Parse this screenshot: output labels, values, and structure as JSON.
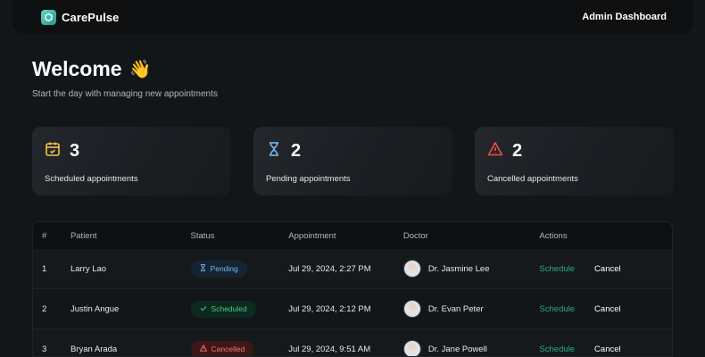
{
  "header": {
    "brand": "CarePulse",
    "right_label": "Admin Dashboard"
  },
  "welcome": {
    "title": "Welcome",
    "emoji": "👋",
    "subtitle": "Start the day with managing new appointments"
  },
  "stats": [
    {
      "count": "3",
      "label": "Scheduled appointments",
      "icon": "calendar-icon",
      "color": "#f5c542"
    },
    {
      "count": "2",
      "label": "Pending appointments",
      "icon": "hourglass-icon",
      "color": "#79b5ec"
    },
    {
      "count": "2",
      "label": "Cancelled appointments",
      "icon": "warning-icon",
      "color": "#f24e43"
    }
  ],
  "table": {
    "columns": [
      "#",
      "Patient",
      "Status",
      "Appointment",
      "Doctor",
      "Actions"
    ],
    "rows": [
      {
        "num": "1",
        "patient": "Larry Lao",
        "status": "Pending",
        "appointment": "Jul 29, 2024, 2:27 PM",
        "doctor": "Dr. Jasmine Lee",
        "schedule": "Schedule",
        "cancel": "Cancel"
      },
      {
        "num": "2",
        "patient": "Justin Angue",
        "status": "Scheduled",
        "appointment": "Jul 29, 2024, 2:12 PM",
        "doctor": "Dr. Evan Peter",
        "schedule": "Schedule",
        "cancel": "Cancel"
      },
      {
        "num": "3",
        "patient": "Bryan Arada",
        "status": "Cancelled",
        "appointment": "Jul 29, 2024, 9:51 AM",
        "doctor": "Dr. Jane Powell",
        "schedule": "Schedule",
        "cancel": "Cancel"
      }
    ]
  }
}
